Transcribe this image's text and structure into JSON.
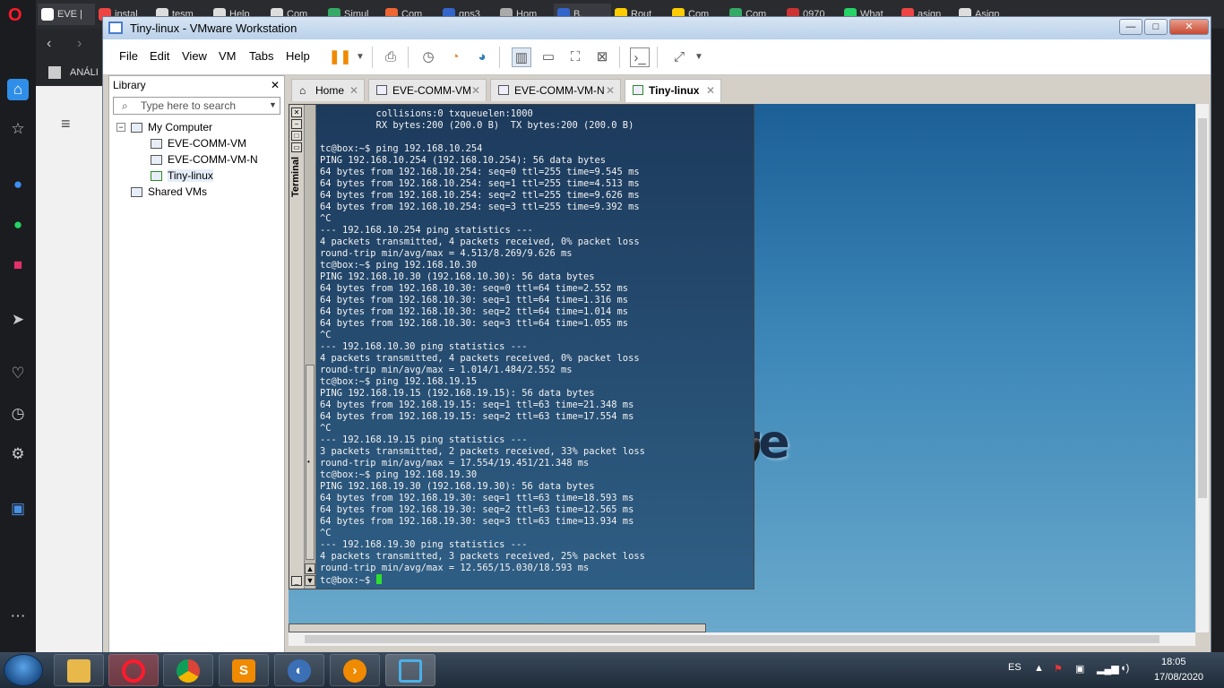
{
  "browser": {
    "tabs": [
      "EVE |",
      "instal",
      "tesm",
      "Help",
      "Com",
      "Simul",
      "Com",
      "gns3",
      "Hom",
      "B.",
      "Rout",
      "Com",
      "Com",
      "0970",
      "What",
      "asign",
      "Asign"
    ],
    "bookmark": "ANÁLI"
  },
  "window": {
    "title": "Tiny-linux - VMware Workstation",
    "minimize": "—",
    "maximize": "□",
    "close": "✕"
  },
  "menu": [
    "File",
    "Edit",
    "View",
    "VM",
    "Tabs",
    "Help"
  ],
  "library": {
    "title": "Library",
    "close": "✕",
    "search_placeholder": "Type here to search",
    "tree": {
      "root": "My Computer",
      "items": [
        "EVE-COMM-VM",
        "EVE-COMM-VM-N",
        "Tiny-linux"
      ],
      "shared": "Shared VMs"
    }
  },
  "tabs": [
    {
      "label": "Home"
    },
    {
      "label": "EVE-COMM-VM"
    },
    {
      "label": "EVE-COMM-VM-N"
    },
    {
      "label": "Tiny-linux"
    }
  ],
  "terminal": {
    "title": "Terminal",
    "lines": [
      "          collisions:0 txqueuelen:1000",
      "          RX bytes:200 (200.0 B)  TX bytes:200 (200.0 B)",
      "",
      "tc@box:~$ ping 192.168.10.254",
      "PING 192.168.10.254 (192.168.10.254): 56 data bytes",
      "64 bytes from 192.168.10.254: seq=0 ttl=255 time=9.545 ms",
      "64 bytes from 192.168.10.254: seq=1 ttl=255 time=4.513 ms",
      "64 bytes from 192.168.10.254: seq=2 ttl=255 time=9.626 ms",
      "64 bytes from 192.168.10.254: seq=3 ttl=255 time=9.392 ms",
      "^C",
      "--- 192.168.10.254 ping statistics ---",
      "4 packets transmitted, 4 packets received, 0% packet loss",
      "round-trip min/avg/max = 4.513/8.269/9.626 ms",
      "tc@box:~$ ping 192.168.10.30",
      "PING 192.168.10.30 (192.168.10.30): 56 data bytes",
      "64 bytes from 192.168.10.30: seq=0 ttl=64 time=2.552 ms",
      "64 bytes from 192.168.10.30: seq=1 ttl=64 time=1.316 ms",
      "64 bytes from 192.168.10.30: seq=2 ttl=64 time=1.014 ms",
      "64 bytes from 192.168.10.30: seq=3 ttl=64 time=1.055 ms",
      "^C",
      "--- 192.168.10.30 ping statistics ---",
      "4 packets transmitted, 4 packets received, 0% packet loss",
      "round-trip min/avg/max = 1.014/1.484/2.552 ms",
      "tc@box:~$ ping 192.168.19.15",
      "PING 192.168.19.15 (192.168.19.15): 56 data bytes",
      "64 bytes from 192.168.19.15: seq=1 ttl=63 time=21.348 ms",
      "64 bytes from 192.168.19.15: seq=2 ttl=63 time=17.554 ms",
      "^C",
      "--- 192.168.19.15 ping statistics ---",
      "3 packets transmitted, 2 packets received, 33% packet loss",
      "round-trip min/avg/max = 17.554/19.451/21.348 ms",
      "tc@box:~$ ping 192.168.19.30",
      "PING 192.168.19.30 (192.168.19.30): 56 data bytes",
      "64 bytes from 192.168.19.30: seq=1 ttl=63 time=18.593 ms",
      "64 bytes from 192.168.19.30: seq=2 ttl=63 time=12.565 ms",
      "64 bytes from 192.168.19.30: seq=3 ttl=63 time=13.934 ms",
      "^C",
      "--- 192.168.19.30 ping statistics ---",
      "4 packets transmitted, 3 packets received, 25% packet loss",
      "round-trip min/avg/max = 12.565/15.030/18.593 ms"
    ],
    "prompt": "tc@box:~$ "
  },
  "desktop_logo": "core",
  "taskbar": {
    "lang": "ES",
    "time": "18:05",
    "date": "17/08/2020"
  },
  "colors": {
    "terminal_cursor": "#2ee02e",
    "opera_red": "#ff1b2d"
  }
}
